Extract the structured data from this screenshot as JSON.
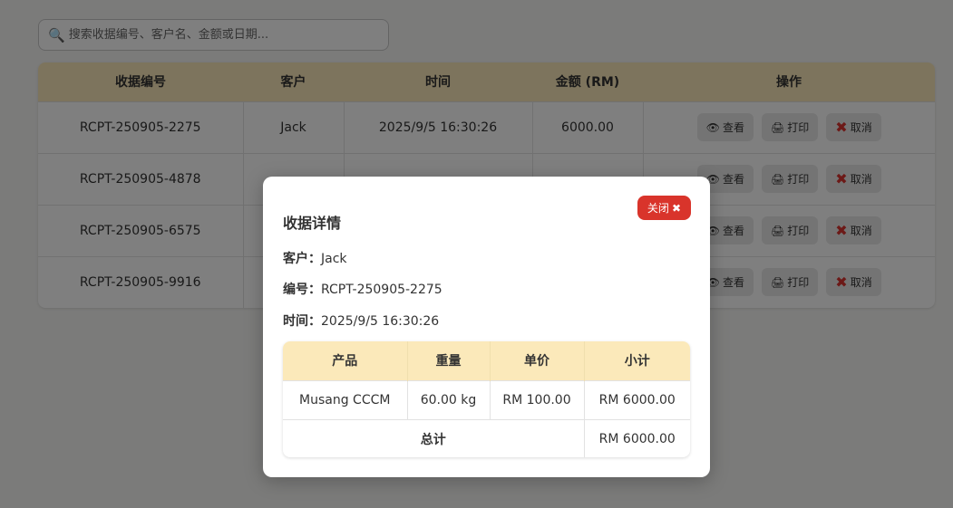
{
  "search": {
    "placeholder": "搜索收据编号、客户名、金额或日期..."
  },
  "table": {
    "headers": [
      "收据编号",
      "客户",
      "时间",
      "金额 (RM)",
      "操作"
    ],
    "rows": [
      {
        "id": "RCPT-250905-2275",
        "customer": "Jack",
        "time": "2025/9/5 16:30:26",
        "amount": "6000.00"
      },
      {
        "id": "RCPT-250905-4878",
        "customer": "",
        "time": "",
        "amount": ""
      },
      {
        "id": "RCPT-250905-6575",
        "customer": "",
        "time": "",
        "amount": ""
      },
      {
        "id": "RCPT-250905-9916",
        "customer": "",
        "time": "",
        "amount": ""
      }
    ],
    "actions": {
      "view": "查看",
      "print": "打印",
      "cancel": "取消"
    }
  },
  "modal": {
    "title": "收据详情",
    "close_label": "关闭",
    "customer_label": "客户：",
    "customer_value": "Jack",
    "id_label": "编号：",
    "id_value": "RCPT-250905-2275",
    "time_label": "时间：",
    "time_value": "2025/9/5 16:30:26",
    "detail_headers": [
      "产品",
      "重量",
      "单价",
      "小计"
    ],
    "items": [
      {
        "product": "Musang CCCM",
        "weight": "60.00 kg",
        "price": "RM 100.00",
        "subtotal": "RM 6000.00"
      }
    ],
    "total_label": "总计",
    "total_value": "RM 6000.00"
  },
  "colors": {
    "header_bg": "#fbe9ba",
    "danger": "#d9342b"
  }
}
